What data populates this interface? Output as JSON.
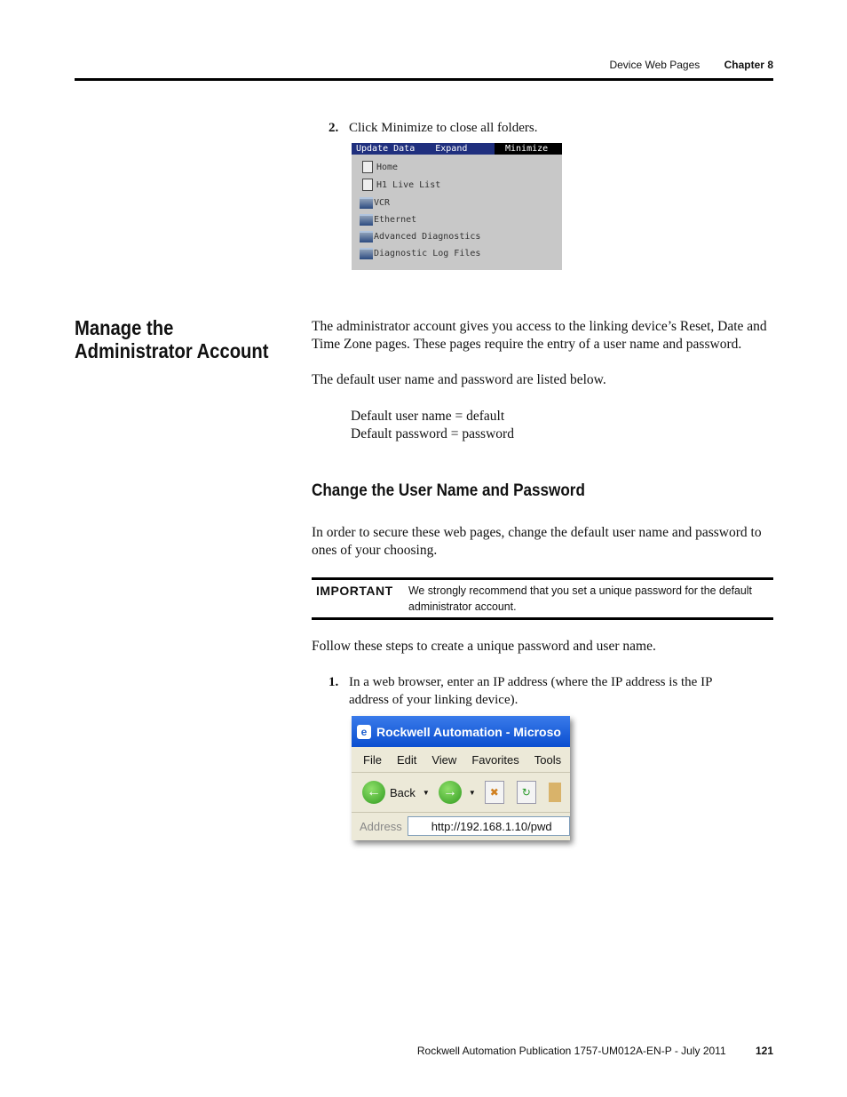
{
  "header": {
    "section": "Device Web Pages",
    "chapter": "Chapter 8"
  },
  "step2": {
    "num": "2.",
    "text": "Click Minimize to close all folders."
  },
  "menu_screenshot": {
    "tabs": [
      "Update Data",
      "Expand",
      "Minimize"
    ],
    "items": [
      {
        "label": "Home",
        "icon": "document-icon"
      },
      {
        "label": "H1 Live List",
        "icon": "document-icon"
      },
      {
        "label": "VCR",
        "icon": "folder-icon"
      },
      {
        "label": "Ethernet",
        "icon": "folder-icon"
      },
      {
        "label": "Advanced Diagnostics",
        "icon": "folder-icon"
      },
      {
        "label": "Diagnostic Log Files",
        "icon": "folder-icon"
      }
    ]
  },
  "section": {
    "title": "Manage the Administrator Account",
    "intro": "The administrator account gives you access to the linking device’s Reset, Date and Time Zone pages. These pages require the entry of a user name and password.",
    "defaults_intro": "The default user name and password are listed below.",
    "default_user": "Default user name = default",
    "default_password": "Default password = password"
  },
  "subsection": {
    "title": "Change the User Name and Password",
    "intro": "In order to secure these web pages, change the default user name and password to ones of your choosing.",
    "important_label": "IMPORTANT",
    "important_text": "We strongly recommend that you set a unique password for the default administrator account.",
    "steps_intro": "Follow these steps to create a unique password and user name."
  },
  "step1": {
    "num": "1.",
    "text": "In a web browser, enter an IP address (where the IP address is the IP address of your linking device)."
  },
  "browser_screenshot": {
    "title": "Rockwell Automation - Microso",
    "menu": [
      "File",
      "Edit",
      "View",
      "Favorites",
      "Tools"
    ],
    "back_label": "Back",
    "address_label": "Address",
    "address_value": "http://192.168.1.10/pwd"
  },
  "footer": {
    "publication": "Rockwell Automation Publication 1757-UM012A-EN-P - July 2011",
    "page": "121"
  }
}
